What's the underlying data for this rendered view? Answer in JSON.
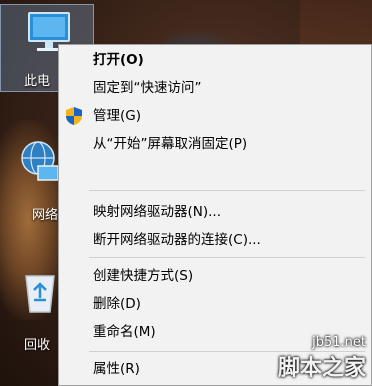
{
  "desktop": {
    "icons": [
      {
        "label": "此电",
        "icon": "this-pc-icon"
      },
      {
        "label": "网络",
        "icon": "network-icon"
      },
      {
        "label": "回收",
        "icon": "recycle-bin-icon"
      }
    ]
  },
  "context_menu": {
    "items": [
      {
        "label": "打开(O)",
        "bold": true
      },
      {
        "label": "固定到“快速访问”"
      },
      {
        "label": "管理(G)",
        "icon": "uac-shield-icon"
      },
      {
        "label": "从“开始”屏幕取消固定(P)"
      },
      {
        "label": "映射网络驱动器(N)..."
      },
      {
        "label": "断开网络驱动器的连接(C)..."
      },
      {
        "label": "创建快捷方式(S)"
      },
      {
        "label": "删除(D)"
      },
      {
        "label": "重命名(M)"
      },
      {
        "label": "属性(R)"
      }
    ]
  },
  "watermark": {
    "url": "jb51.net",
    "brand": "脚本之家"
  }
}
